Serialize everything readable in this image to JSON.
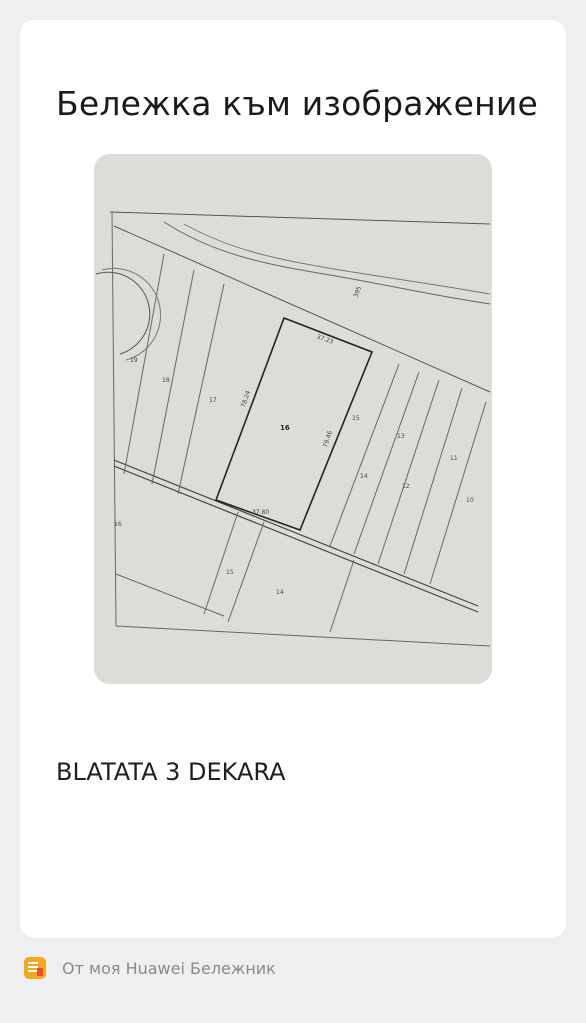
{
  "note": {
    "title": "Бележка към изображение",
    "text": "BLATATA 3 DEKARA"
  },
  "image": {
    "icon": "cadastral-map-photo",
    "labels": {
      "l16": "16",
      "l17a": "17",
      "l18a": "18",
      "l19": "19",
      "l15a": "15",
      "l14a": "14",
      "l13": "13",
      "l12": "12",
      "l11": "11",
      "l10": "10",
      "l15b": "15",
      "l14b": "14",
      "l16b": "16",
      "d1": "78.24",
      "d2": "79.46",
      "d3": "37.80",
      "d4": "37.23",
      "r": "395"
    }
  },
  "footer": {
    "icon": "notepad-icon",
    "text": "От моя Huawei Бележник"
  }
}
